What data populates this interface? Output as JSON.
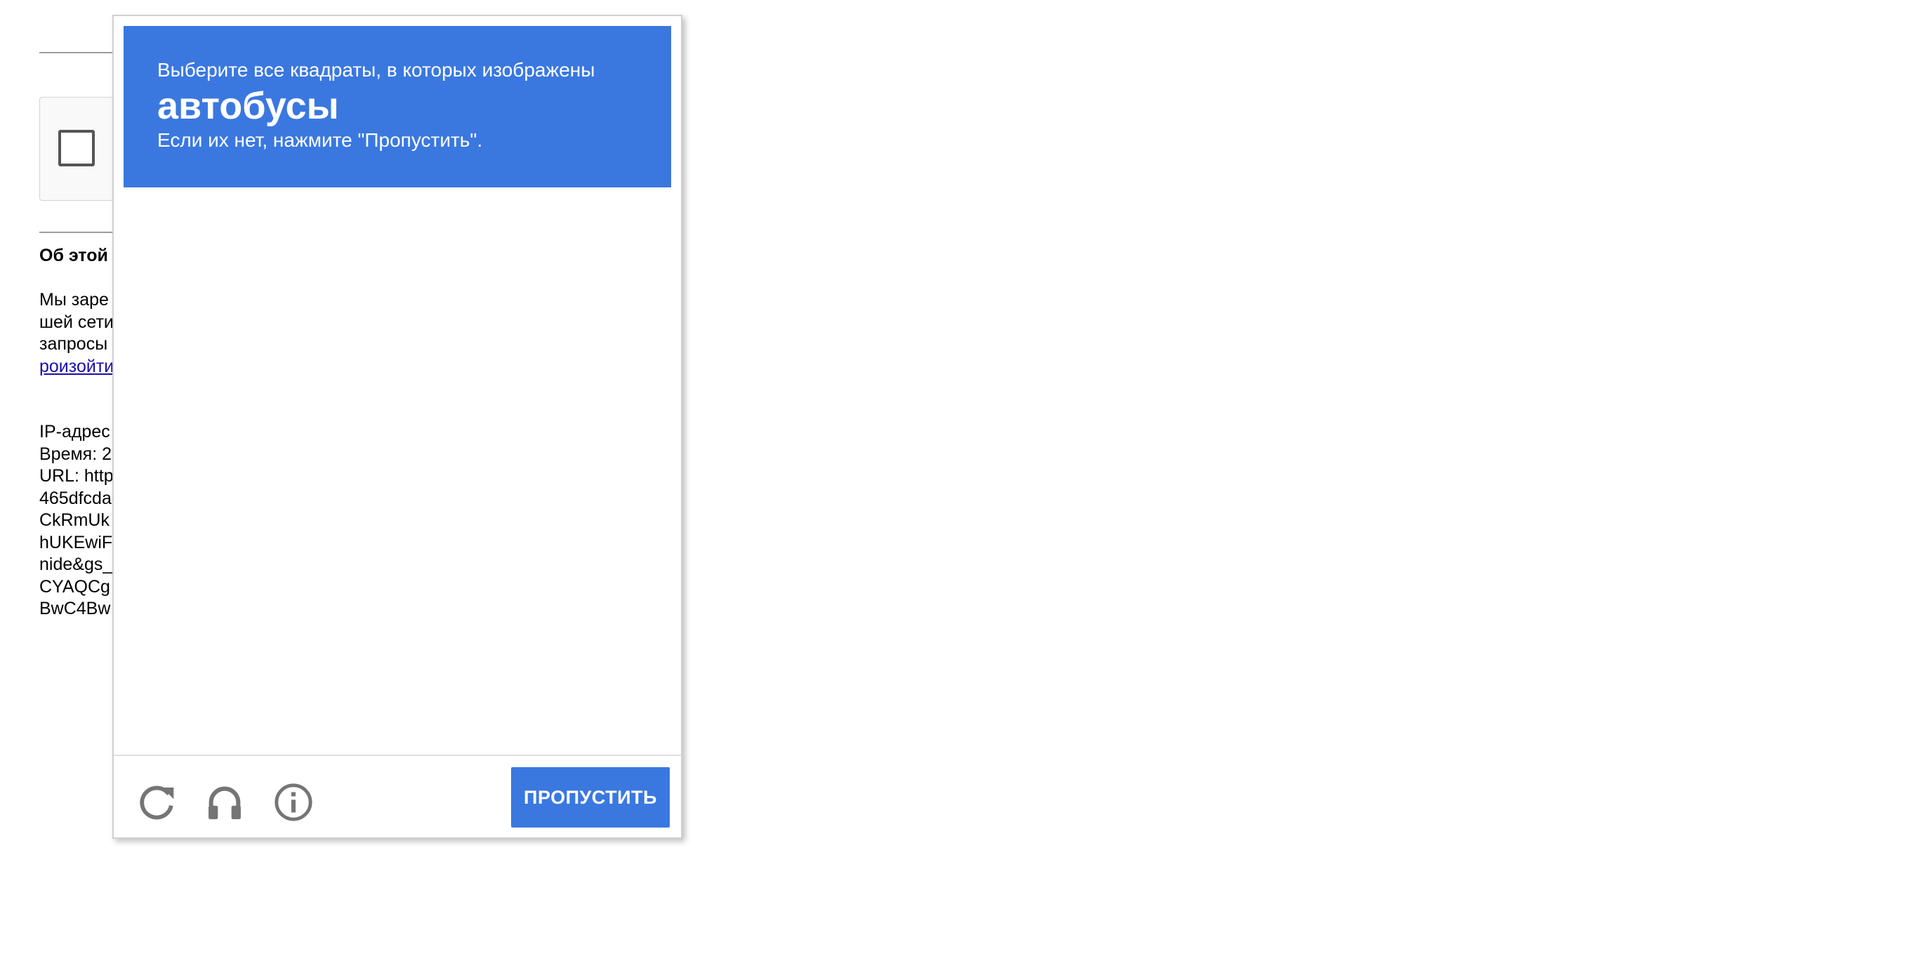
{
  "background_page": {
    "heading": "Об этой",
    "paragraph_lines": [
      "Мы заре",
      "шей сети",
      "запросы"
    ],
    "paragraph_link": "роизойти",
    "info_lines": [
      "IP-адрес",
      "Время: 2",
      "URL: http",
      "465dfcda",
      "CkRmUk",
      "hUKEwiF",
      "nide&gs_",
      "CYAQCg",
      "BwC4Bw"
    ]
  },
  "challenge": {
    "instruction_line1": "Выберите все квадраты, в которых изображены",
    "target": "автобусы",
    "instruction_line3": "Если их нет, нажмите \"Пропустить\".",
    "grid_size": 4,
    "accent_color": "#3a78e0",
    "footer": {
      "reload_icon": "reload-icon",
      "audio_icon": "headphones-icon",
      "info_icon": "info-icon",
      "skip_label": "ПРОПУСТИТЬ"
    }
  }
}
